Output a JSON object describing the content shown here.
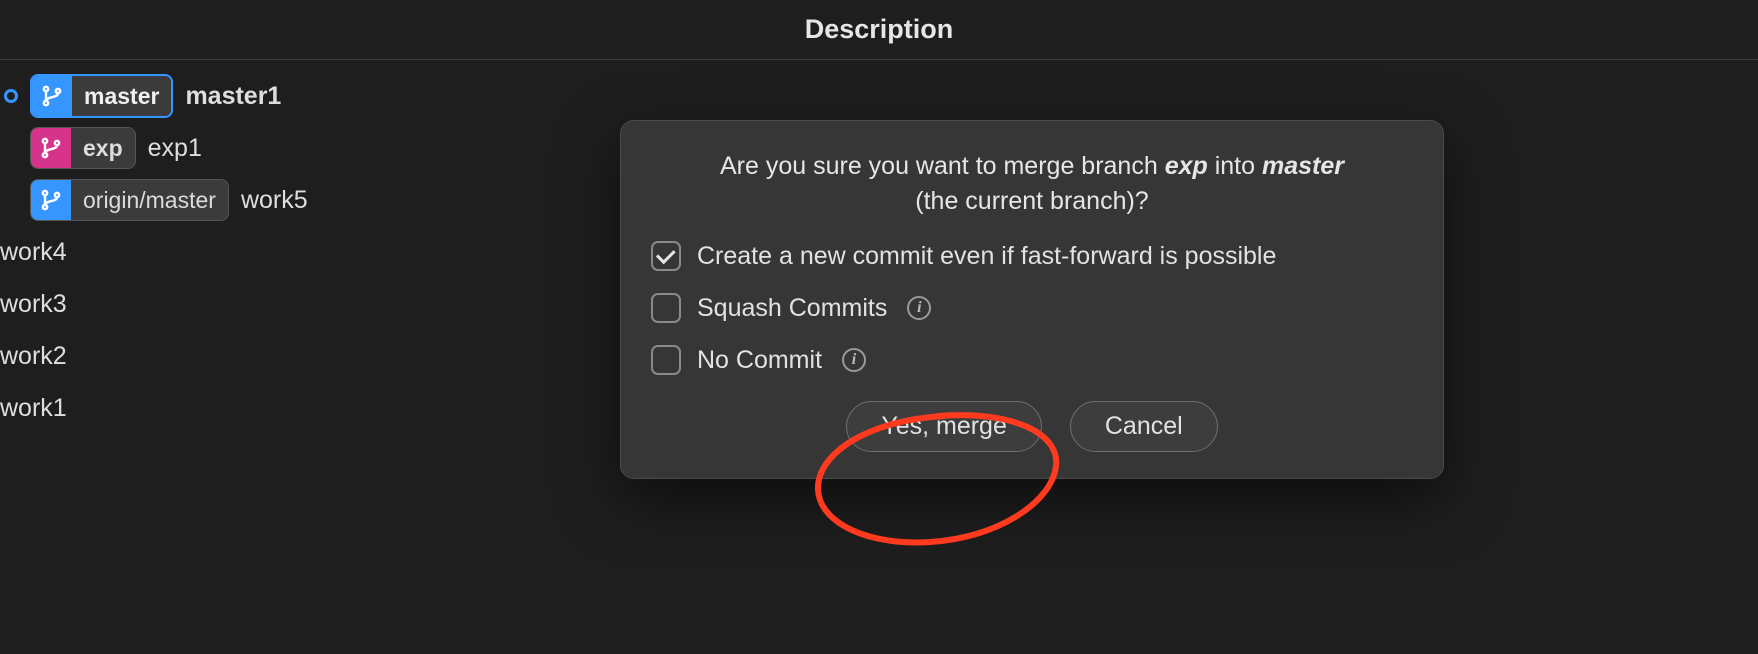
{
  "header": {
    "title": "Description"
  },
  "commits": [
    {
      "badge": "master",
      "message": "master1",
      "bold": true
    },
    {
      "badge": "exp",
      "message": "exp1"
    },
    {
      "badge": "origin/master",
      "message": "work5"
    },
    {
      "message": "work4"
    },
    {
      "message": "work3"
    },
    {
      "message": "work2"
    },
    {
      "message": "work1"
    }
  ],
  "dialog": {
    "prompt_prefix": "Are you sure you want to merge branch ",
    "source_branch": "exp",
    "prompt_mid": " into ",
    "target_branch": "master",
    "prompt_suffix": " (the current branch)?",
    "options": {
      "no_ff": {
        "label": "Create a new commit even if fast-forward is possible",
        "checked": true,
        "info": false
      },
      "squash": {
        "label": "Squash Commits",
        "checked": false,
        "info": true
      },
      "no_commit": {
        "label": "No Commit",
        "checked": false,
        "info": true
      }
    },
    "buttons": {
      "confirm": "Yes, merge",
      "cancel": "Cancel"
    }
  },
  "icons": {
    "git_branch": "git-branch-icon",
    "info": "i"
  },
  "annotation": {
    "highlight_confirm_button": true,
    "color": "#ff3a1f"
  }
}
